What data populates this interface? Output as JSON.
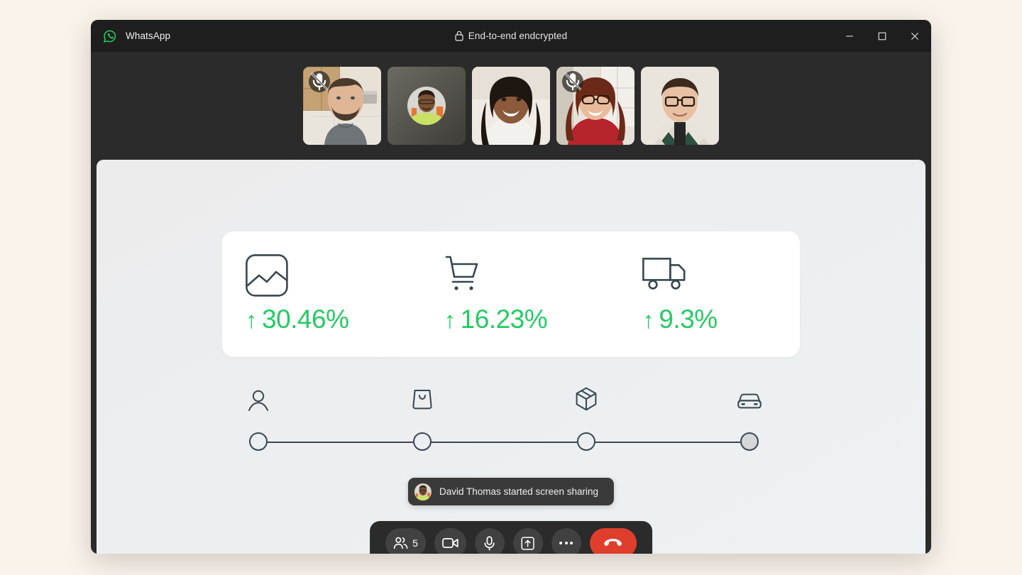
{
  "theme": {
    "page_background": "#faf3ea",
    "window_background": "#2b2b2b",
    "titlebar_background": "#1e1e1e",
    "accent_green": "#25ca63",
    "whatsapp_green": "#25d366",
    "end_call_red": "#e03e2d",
    "stage_gradient_start": "#ececec",
    "stage_gradient_end": "#eef1f3",
    "icon_ink": "#3b4754"
  },
  "titlebar": {
    "app_name": "WhatsApp",
    "logo_icon": "whatsapp-logo-icon",
    "encryption_icon": "lock-icon",
    "encryption_label": "End-to-end endcrypted",
    "controls": [
      {
        "name": "minimize-button",
        "icon": "minimize-icon"
      },
      {
        "name": "maximize-button",
        "icon": "maximize-icon"
      },
      {
        "name": "close-button",
        "icon": "close-icon"
      }
    ]
  },
  "filmstrip": {
    "participants": [
      {
        "id": "p1",
        "muted": true,
        "video_on": true,
        "mute_icon": "microphone-muted-icon"
      },
      {
        "id": "p2",
        "muted": false,
        "video_on": false,
        "mute_icon": ""
      },
      {
        "id": "p3",
        "muted": false,
        "video_on": true,
        "mute_icon": ""
      },
      {
        "id": "p4",
        "muted": true,
        "video_on": true,
        "mute_icon": "microphone-muted-icon"
      },
      {
        "id": "p5",
        "muted": false,
        "video_on": true,
        "mute_icon": ""
      }
    ]
  },
  "shared_screen": {
    "stats_card": {
      "stats": [
        {
          "icon": "chart-image-icon",
          "trend": "up",
          "arrow": "↑",
          "value": "30.46%"
        },
        {
          "icon": "shopping-cart-icon",
          "trend": "up",
          "arrow": "↑",
          "value": "16.23%"
        },
        {
          "icon": "delivery-truck-icon",
          "trend": "up",
          "arrow": "↑",
          "value": "9.3%"
        }
      ]
    },
    "stepper": {
      "steps": [
        {
          "icon": "person-icon",
          "position_pct": 0,
          "state": "open"
        },
        {
          "icon": "shopping-bag-icon",
          "position_pct": 33.33,
          "state": "open"
        },
        {
          "icon": "package-box-icon",
          "position_pct": 66.66,
          "state": "open"
        },
        {
          "icon": "car-icon",
          "position_pct": 100,
          "state": "filled"
        }
      ]
    }
  },
  "toast": {
    "avatar_icon": "participant-avatar",
    "message": "David Thomas started screen sharing"
  },
  "control_bar": {
    "buttons": [
      {
        "name": "participants-button",
        "icon": "people-icon",
        "label": "5"
      },
      {
        "name": "camera-button",
        "icon": "video-camera-icon",
        "label": ""
      },
      {
        "name": "microphone-button",
        "icon": "microphone-icon",
        "label": ""
      },
      {
        "name": "share-screen-button",
        "icon": "share-screen-icon",
        "label": ""
      },
      {
        "name": "more-options-button",
        "icon": "more-horizontal-icon",
        "label": ""
      },
      {
        "name": "end-call-button",
        "icon": "end-call-icon",
        "label": ""
      }
    ]
  }
}
